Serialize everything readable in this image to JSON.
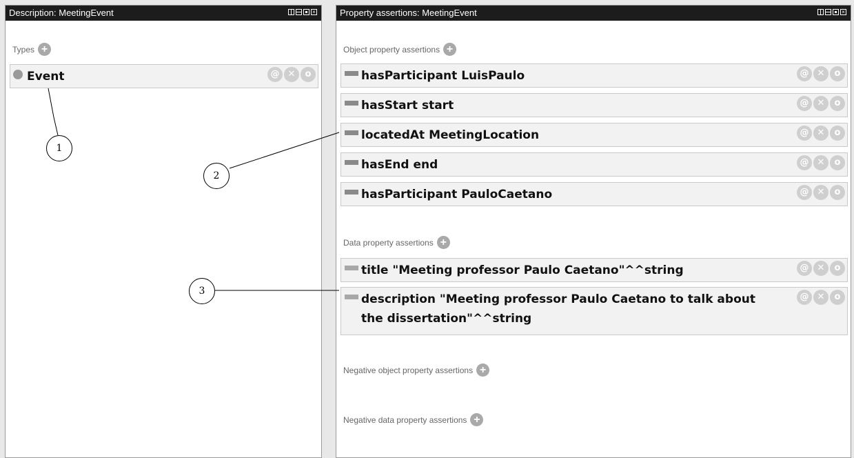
{
  "left_panel": {
    "title": "Description: MeetingEvent",
    "types_label": "Types",
    "types": [
      {
        "label": "Event"
      }
    ]
  },
  "right_panel": {
    "title": "Property assertions: MeetingEvent",
    "object_header": "Object property assertions",
    "object_assertions": [
      {
        "label": "hasParticipant  LuisPaulo"
      },
      {
        "label": "hasStart  start"
      },
      {
        "label": "locatedAt  MeetingLocation"
      },
      {
        "label": "hasEnd  end"
      },
      {
        "label": "hasParticipant  PauloCaetano"
      }
    ],
    "data_header": "Data property assertions",
    "data_assertions": [
      {
        "label": "title  \"Meeting professor Paulo Caetano\"^^string"
      },
      {
        "label": "description  \"Meeting professor Paulo Caetano to talk about the dissertation\"^^string"
      }
    ],
    "neg_object_header": "Negative object property assertions",
    "neg_data_header": "Negative data property assertions"
  },
  "row_buttons": {
    "annotate": "@",
    "remove": "✕",
    "edit": "o"
  },
  "callouts": [
    "1",
    "2",
    "3"
  ]
}
